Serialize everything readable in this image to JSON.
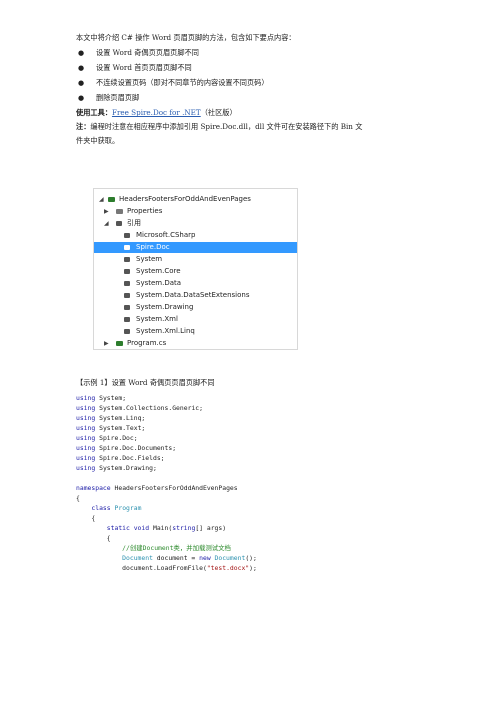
{
  "intro": {
    "line": "本文中将介绍 C# 操作 Word 页眉页脚的方法，包含如下要点内容：",
    "bullets": [
      "设置 Word 奇偶页页眉页脚不同",
      "设置 Word 首页页眉页脚不同",
      "不连续设置页码（即对不同章节的内容设置不同页码）",
      "删除页眉页脚"
    ]
  },
  "tools": {
    "label": "使用工具：",
    "link": "Free Spire.Doc for .NET",
    "suffix": "（社区版）"
  },
  "note": {
    "label": "注：",
    "line1": "编程时注意在相应程序中添加引用 Spire.Doc.dll，dll 文件可在安装路径下的 Bin 文",
    "line2": "件夹中获取。"
  },
  "solution_explorer": {
    "project": "HeadersFootersForOddAndEvenPages",
    "properties": "Properties",
    "references_label": "引用",
    "references": [
      "Microsoft.CSharp",
      "Spire.Doc",
      "System",
      "System.Core",
      "System.Data",
      "System.Data.DataSetExtensions",
      "System.Drawing",
      "System.Xml",
      "System.Xml.Linq"
    ],
    "selected_reference": "Spire.Doc",
    "program_file": "Program.cs"
  },
  "example": {
    "heading": "【示例 1】设置 Word 奇偶页页眉页脚不同"
  },
  "code": {
    "usings": [
      "System;",
      "System.Collections.Generic;",
      "System.Linq;",
      "System.Text;",
      "Spire.Doc;",
      "Spire.Doc.Documents;",
      "Spire.Doc.Fields;",
      "System.Drawing;"
    ],
    "using_kw": "using",
    "namespace_kw": "namespace",
    "namespace_name": "HeadersFootersForOddAndEvenPages",
    "open_brace": "{",
    "class_kw": "class",
    "class_name": "Program",
    "main_sig_kw": "static void",
    "main_sig_rest": "Main(",
    "main_sig_type": "string",
    "main_sig_end": "[] args)",
    "comment": "//创建Document类，并加载测试文档",
    "decl_type": "Document",
    "decl_rest": " document = ",
    "new_kw": "new",
    "decl_ctor": " Document",
    "decl_end": "();",
    "load_pre": "document.LoadFromFile(",
    "load_str": "\"test.docx\"",
    "load_end": ");"
  }
}
